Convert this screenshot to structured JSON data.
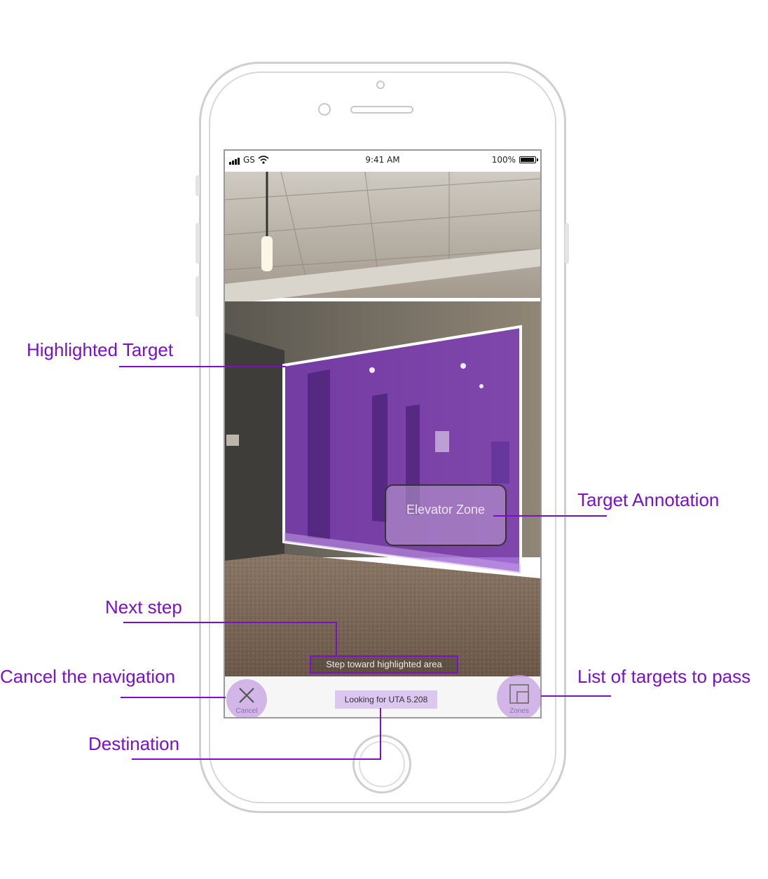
{
  "status_bar": {
    "carrier": "GS",
    "time": "9:41 AM",
    "battery": "100%",
    "battery_level": 1.0
  },
  "ar_view": {
    "target_annotation": "Elevator Zone",
    "next_step": "Step toward highlighted area",
    "highlight_color": "#7a2fc0"
  },
  "bottom_bar": {
    "cancel_label": "Cancel",
    "destination": "Looking for UTA 5.208",
    "zones_label": "Zones"
  },
  "callouts": {
    "highlighted_target": "Highlighted Target",
    "target_annotation": "Target Annotation",
    "next_step": "Next step",
    "cancel_navigation": "Cancel the navigation",
    "list_of_targets": "List of targets to pass",
    "destination": "Destination"
  },
  "colors": {
    "accent": "#7a10c9",
    "button_fill": "#c4a0e2",
    "destination_fill": "#dcc7f0"
  }
}
